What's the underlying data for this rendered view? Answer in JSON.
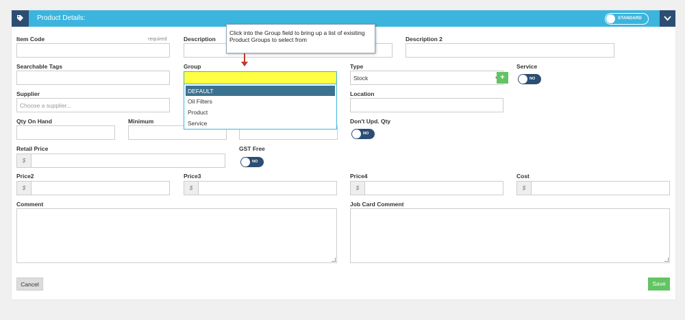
{
  "header": {
    "title": "Product Details:",
    "mode_label": "STANDARD",
    "icons": {
      "tag": "tag-icon",
      "collapse": "chevron-down-icon"
    },
    "colors": {
      "bar": "#3bb5dd",
      "dark": "#2c4e73"
    }
  },
  "callout": {
    "text": "Click into the Group field to bring up a list of exisiting Product Groups to select from"
  },
  "fields": {
    "item_code": {
      "label": "Item Code",
      "required_label": "required",
      "value": ""
    },
    "description": {
      "label": "Description",
      "value": ""
    },
    "description_2": {
      "label": "Description 2",
      "value": ""
    },
    "searchable_tags": {
      "label": "Searchable Tags",
      "value": ""
    },
    "group": {
      "label": "Group",
      "value": "",
      "add_icon": "plus-icon"
    },
    "type": {
      "label": "Type",
      "value": "Stock"
    },
    "service": {
      "label": "Service",
      "toggle": "NO"
    },
    "supplier": {
      "label": "Supplier",
      "placeholder": "Choose a supplier..."
    },
    "location": {
      "label": "Location",
      "value": ""
    },
    "qty_on_hand": {
      "label": "Qty On Hand",
      "value": ""
    },
    "minimum": {
      "label": "Minimum",
      "value": ""
    },
    "dont_upd_qty": {
      "label": "Don't Upd. Qty",
      "toggle": "NO"
    },
    "retail_price": {
      "label": "Retail Price",
      "currency": "$"
    },
    "gst_free": {
      "label": "GST Free",
      "toggle": "NO"
    },
    "price2": {
      "label": "Price2",
      "currency": "$"
    },
    "price3": {
      "label": "Price3",
      "currency": "$"
    },
    "price4": {
      "label": "Price4",
      "currency": "$"
    },
    "cost": {
      "label": "Cost",
      "currency": "$"
    },
    "comment": {
      "label": "Comment"
    },
    "job_card_comment": {
      "label": "Job Card Comment"
    }
  },
  "group_dropdown": {
    "options": [
      "DEFAULT",
      "Oil Filters",
      "Product",
      "Service"
    ],
    "highlighted": "DEFAULT"
  },
  "buttons": {
    "cancel": "Cancel",
    "save": "Save"
  },
  "colors": {
    "save": "#62c462",
    "highlight": "#ffff44",
    "toggle": "#2c4e73"
  }
}
